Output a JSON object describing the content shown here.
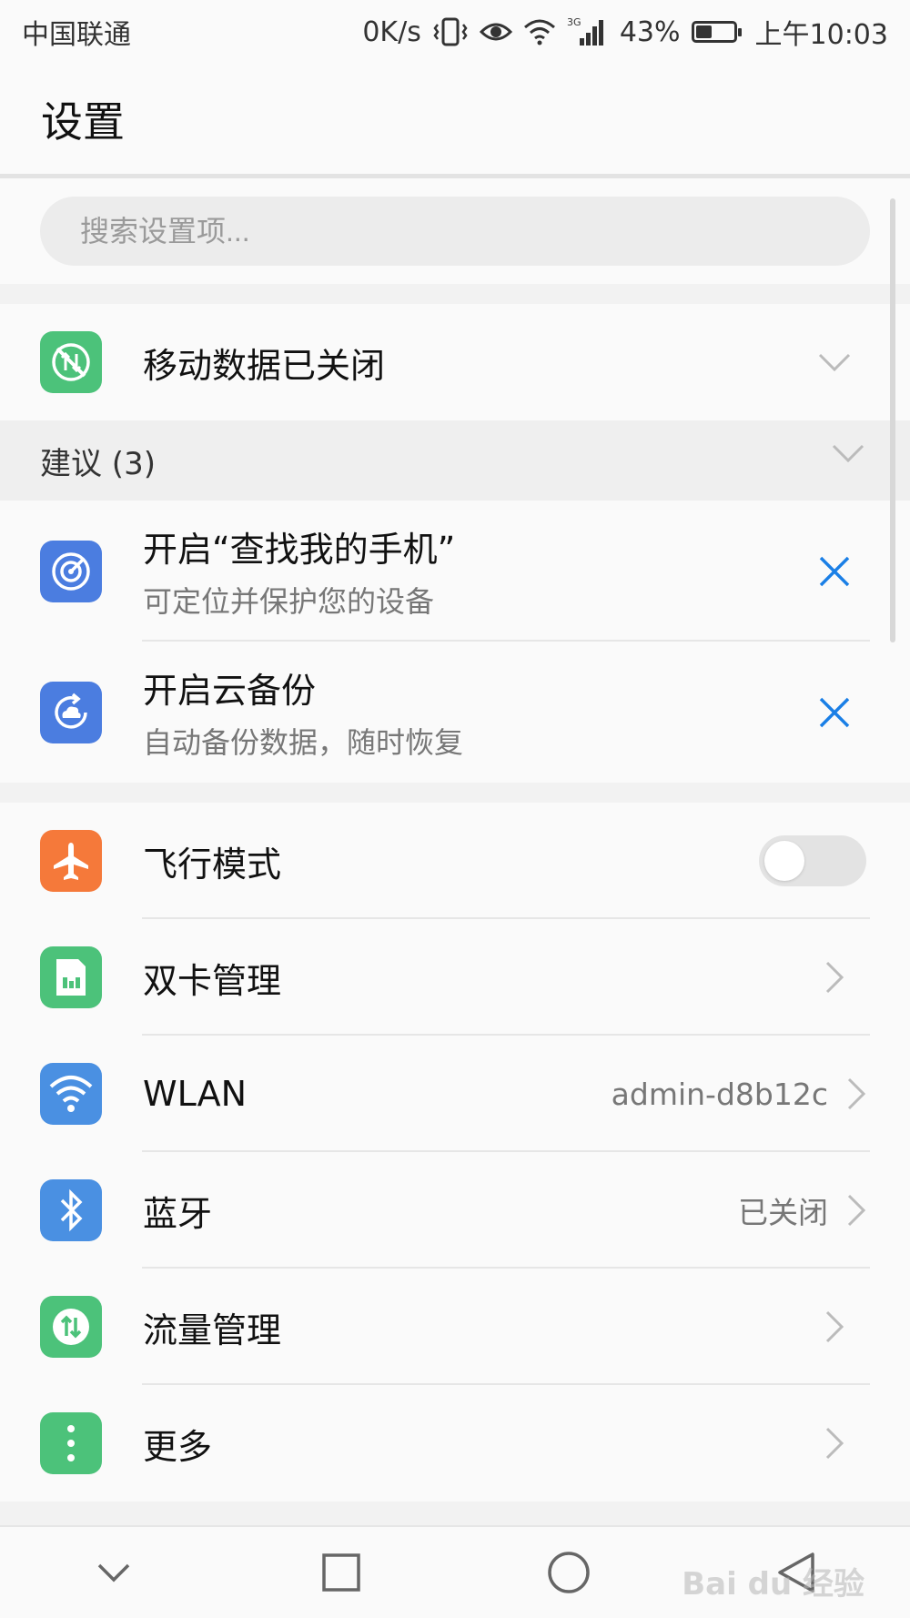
{
  "status_bar": {
    "carrier": "中国联通",
    "speed": "0K/s",
    "network_type": "3G",
    "battery": "43%",
    "battery_level": 0.43,
    "time": "上午10:03",
    "icons": [
      "vibrate-icon",
      "eye-icon",
      "wifi-icon",
      "signal-icon",
      "battery-icon"
    ]
  },
  "header": {
    "title": "设置"
  },
  "search": {
    "placeholder": "搜索设置项..."
  },
  "mobile_data": {
    "label": "移动数据已关闭",
    "icon": "mobile-data-off-icon",
    "color": "#4cc27a"
  },
  "suggestions": {
    "title": "建议 (3)",
    "items": [
      {
        "title": "开启“查找我的手机”",
        "subtitle": "可定位并保护您的设备",
        "icon": "radar-icon",
        "color": "#4b7de0"
      },
      {
        "title": "开启云备份",
        "subtitle": "自动备份数据，随时恢复",
        "icon": "cloud-backup-icon",
        "color": "#4b7de0"
      }
    ]
  },
  "settings": {
    "items": [
      {
        "label": "飞行模式",
        "icon": "airplane-icon",
        "color": "#f5793a",
        "toggle_on": false
      },
      {
        "label": "双卡管理",
        "icon": "sim-card-icon",
        "color": "#4cc27a"
      },
      {
        "label": "WLAN",
        "value": "admin-d8b12c",
        "icon": "wifi-icon",
        "color": "#4a90e2"
      },
      {
        "label": "蓝牙",
        "value": "已关闭",
        "icon": "bluetooth-icon",
        "color": "#4a90e2"
      },
      {
        "label": "流量管理",
        "icon": "data-usage-icon",
        "color": "#4cc27a"
      },
      {
        "label": "更多",
        "icon": "more-icon",
        "color": "#4cc27a"
      }
    ]
  },
  "accent_color": "#1a7fe6",
  "watermark": "Bai du 经验"
}
